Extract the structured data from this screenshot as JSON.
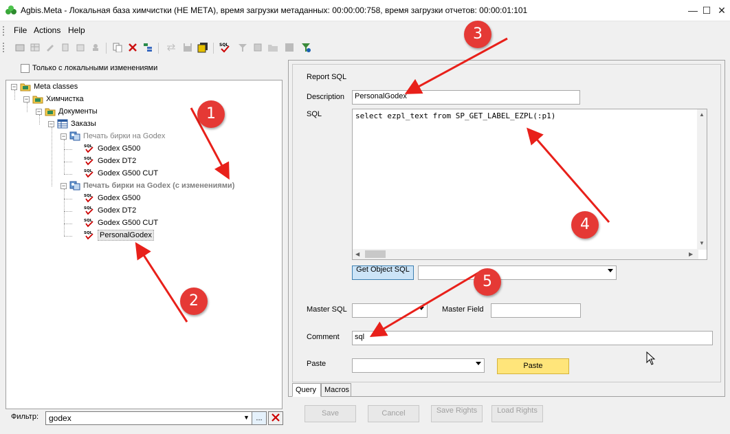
{
  "window": {
    "title": "Agbis.Meta - Локальная база химчистки (НЕ МЕТА), время загрузки метаданных: 00:00:00:758, время загрузки отчетов: 00:00:01:101",
    "minimize": "—",
    "maximize": "☐",
    "close": "✕"
  },
  "menu": {
    "file": "File",
    "actions": "Actions",
    "help": "Help"
  },
  "left": {
    "local_changes_label": "Только с локальными изменениями",
    "tree": [
      {
        "label": "Meta classes"
      },
      {
        "label": "Химчистка"
      },
      {
        "label": "Документы"
      },
      {
        "label": "Заказы"
      },
      {
        "label": "Печать бирки на Godex"
      },
      {
        "label": "Godex G500"
      },
      {
        "label": "Godex DT2"
      },
      {
        "label": "Godex G500 CUT"
      },
      {
        "label": "Печать бирки на Godex (с изменениями)"
      },
      {
        "label": "Godex G500"
      },
      {
        "label": "Godex DT2"
      },
      {
        "label": "Godex G500 CUT"
      },
      {
        "label": "PersonalGodex"
      }
    ],
    "filter": {
      "label": "Фильтр:",
      "value": "godex",
      "dots": "..."
    }
  },
  "right": {
    "report_sql_label": "Report SQL",
    "description_label": "Description",
    "description_value": "PersonalGodex",
    "sql_label": "SQL",
    "sql_value": "select ezpl_text from SP_GET_LABEL_EZPL(:p1)",
    "get_object_sql": "Get Object SQL",
    "master_sql_label": "Master SQL",
    "master_field_label": "Master Field",
    "comment_label": "Comment",
    "comment_value": "sql",
    "paste_label": "Paste",
    "paste_button": "Paste",
    "tabs": [
      "Query",
      "Macros"
    ]
  },
  "footer_buttons": {
    "save": "Save",
    "cancel": "Cancel",
    "save_rights": "Save Rights",
    "load_rights": "Load Rights"
  },
  "annotations": [
    "1",
    "2",
    "3",
    "4",
    "5"
  ],
  "colors": {
    "badge": "#e53935",
    "arrow": "#e8201a",
    "paste_button": "#ffe57a"
  }
}
